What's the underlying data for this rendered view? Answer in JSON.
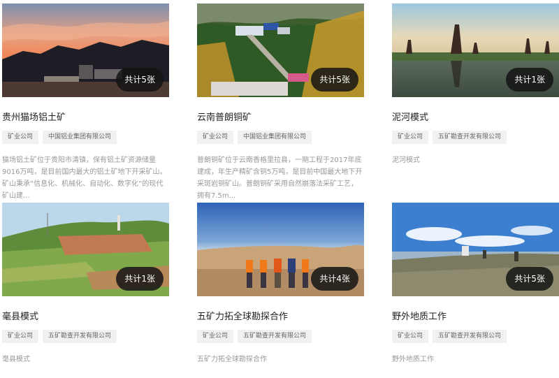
{
  "cards": [
    {
      "title": "贵州猫场铝土矿",
      "count": "共计5张",
      "tags": [
        "矿业公司",
        "中国铝业集团有限公司"
      ],
      "desc": "猫场铝土矿位于贵阳市清镇，保有铝土矿资源储量9016万吨，是目前国内最大的铝土矿地下开采矿山。矿山秉承“信息化、机械化、自动化、数字化”的现代矿山建..."
    },
    {
      "title": "云南普朗铜矿",
      "count": "共计5张",
      "tags": [
        "矿业公司",
        "中国铝业集团有限公司"
      ],
      "desc": "普朗铜矿位于云南香格里拉县，一期工程于2017年底建成，年生产精矿含铜5万吨，是目前中国最大地下开采斑岩铜矿山。普朗铜矿采用自然崩落法采矿工艺，拥有7.5m..."
    },
    {
      "title": "泥河模式",
      "count": "共计1张",
      "tags": [
        "矿业公司",
        "五矿勘查开发有限公司"
      ],
      "desc": "泥河模式"
    },
    {
      "title": "毫县模式",
      "count": "共计1张",
      "tags": [
        "矿业公司",
        "五矿勘查开发有限公司"
      ],
      "desc": "毫县模式"
    },
    {
      "title": "五矿力拓全球勘探合作",
      "count": "共计4张",
      "tags": [
        "矿业公司",
        "五矿勘查开发有限公司"
      ],
      "desc": "五矿力拓全球勘探合作"
    },
    {
      "title": "野外地质工作",
      "count": "共计5张",
      "tags": [
        "矿业公司",
        "五矿勘查开发有限公司"
      ],
      "desc": "野外地质工作"
    }
  ]
}
